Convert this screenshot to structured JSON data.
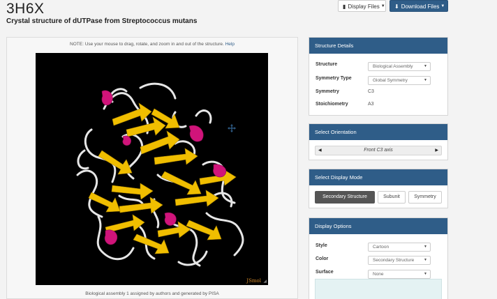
{
  "header": {
    "pdb_id": "3H6X",
    "subtitle": "Crystal structure of dUTPase from Streptococcus mutans",
    "display_files_label": "Display Files",
    "download_files_label": "Download Files"
  },
  "viewer": {
    "note_text": "NOTE: Use your mouse to drag, rotate, and zoom in and out of the structure.",
    "help_label": "Help",
    "jsmol_label": "JSmol",
    "caption": "Biological assembly 1 assigned by authors and generated by PISA"
  },
  "structure_details": {
    "heading": "Structure Details",
    "structure_label": "Structure",
    "structure_value": "Biological Assembly",
    "symmetry_type_label": "Symmetry Type",
    "symmetry_type_value": "Global Symmetry",
    "symmetry_label": "Symmetry",
    "symmetry_value": "C3",
    "stoichiometry_label": "Stoichiometry",
    "stoichiometry_value": "A3"
  },
  "orientation": {
    "heading": "Select Orientation",
    "current": "Front C3 axis"
  },
  "display_mode": {
    "heading": "Select Display Mode",
    "modes": [
      "Secondary Structure",
      "Subunit",
      "Symmetry"
    ],
    "active": "Secondary Structure"
  },
  "display_options": {
    "heading": "Display Options",
    "style_label": "Style",
    "style_value": "Cartoon",
    "color_label": "Color",
    "color_value": "Secondary Structure",
    "surface_label": "Surface",
    "surface_value": "None"
  },
  "colors": {
    "brand_blue": "#2f5d88",
    "strand_yellow": "#f0be00",
    "helix_magenta": "#d0147a",
    "coil_white": "#e6e6e6"
  }
}
